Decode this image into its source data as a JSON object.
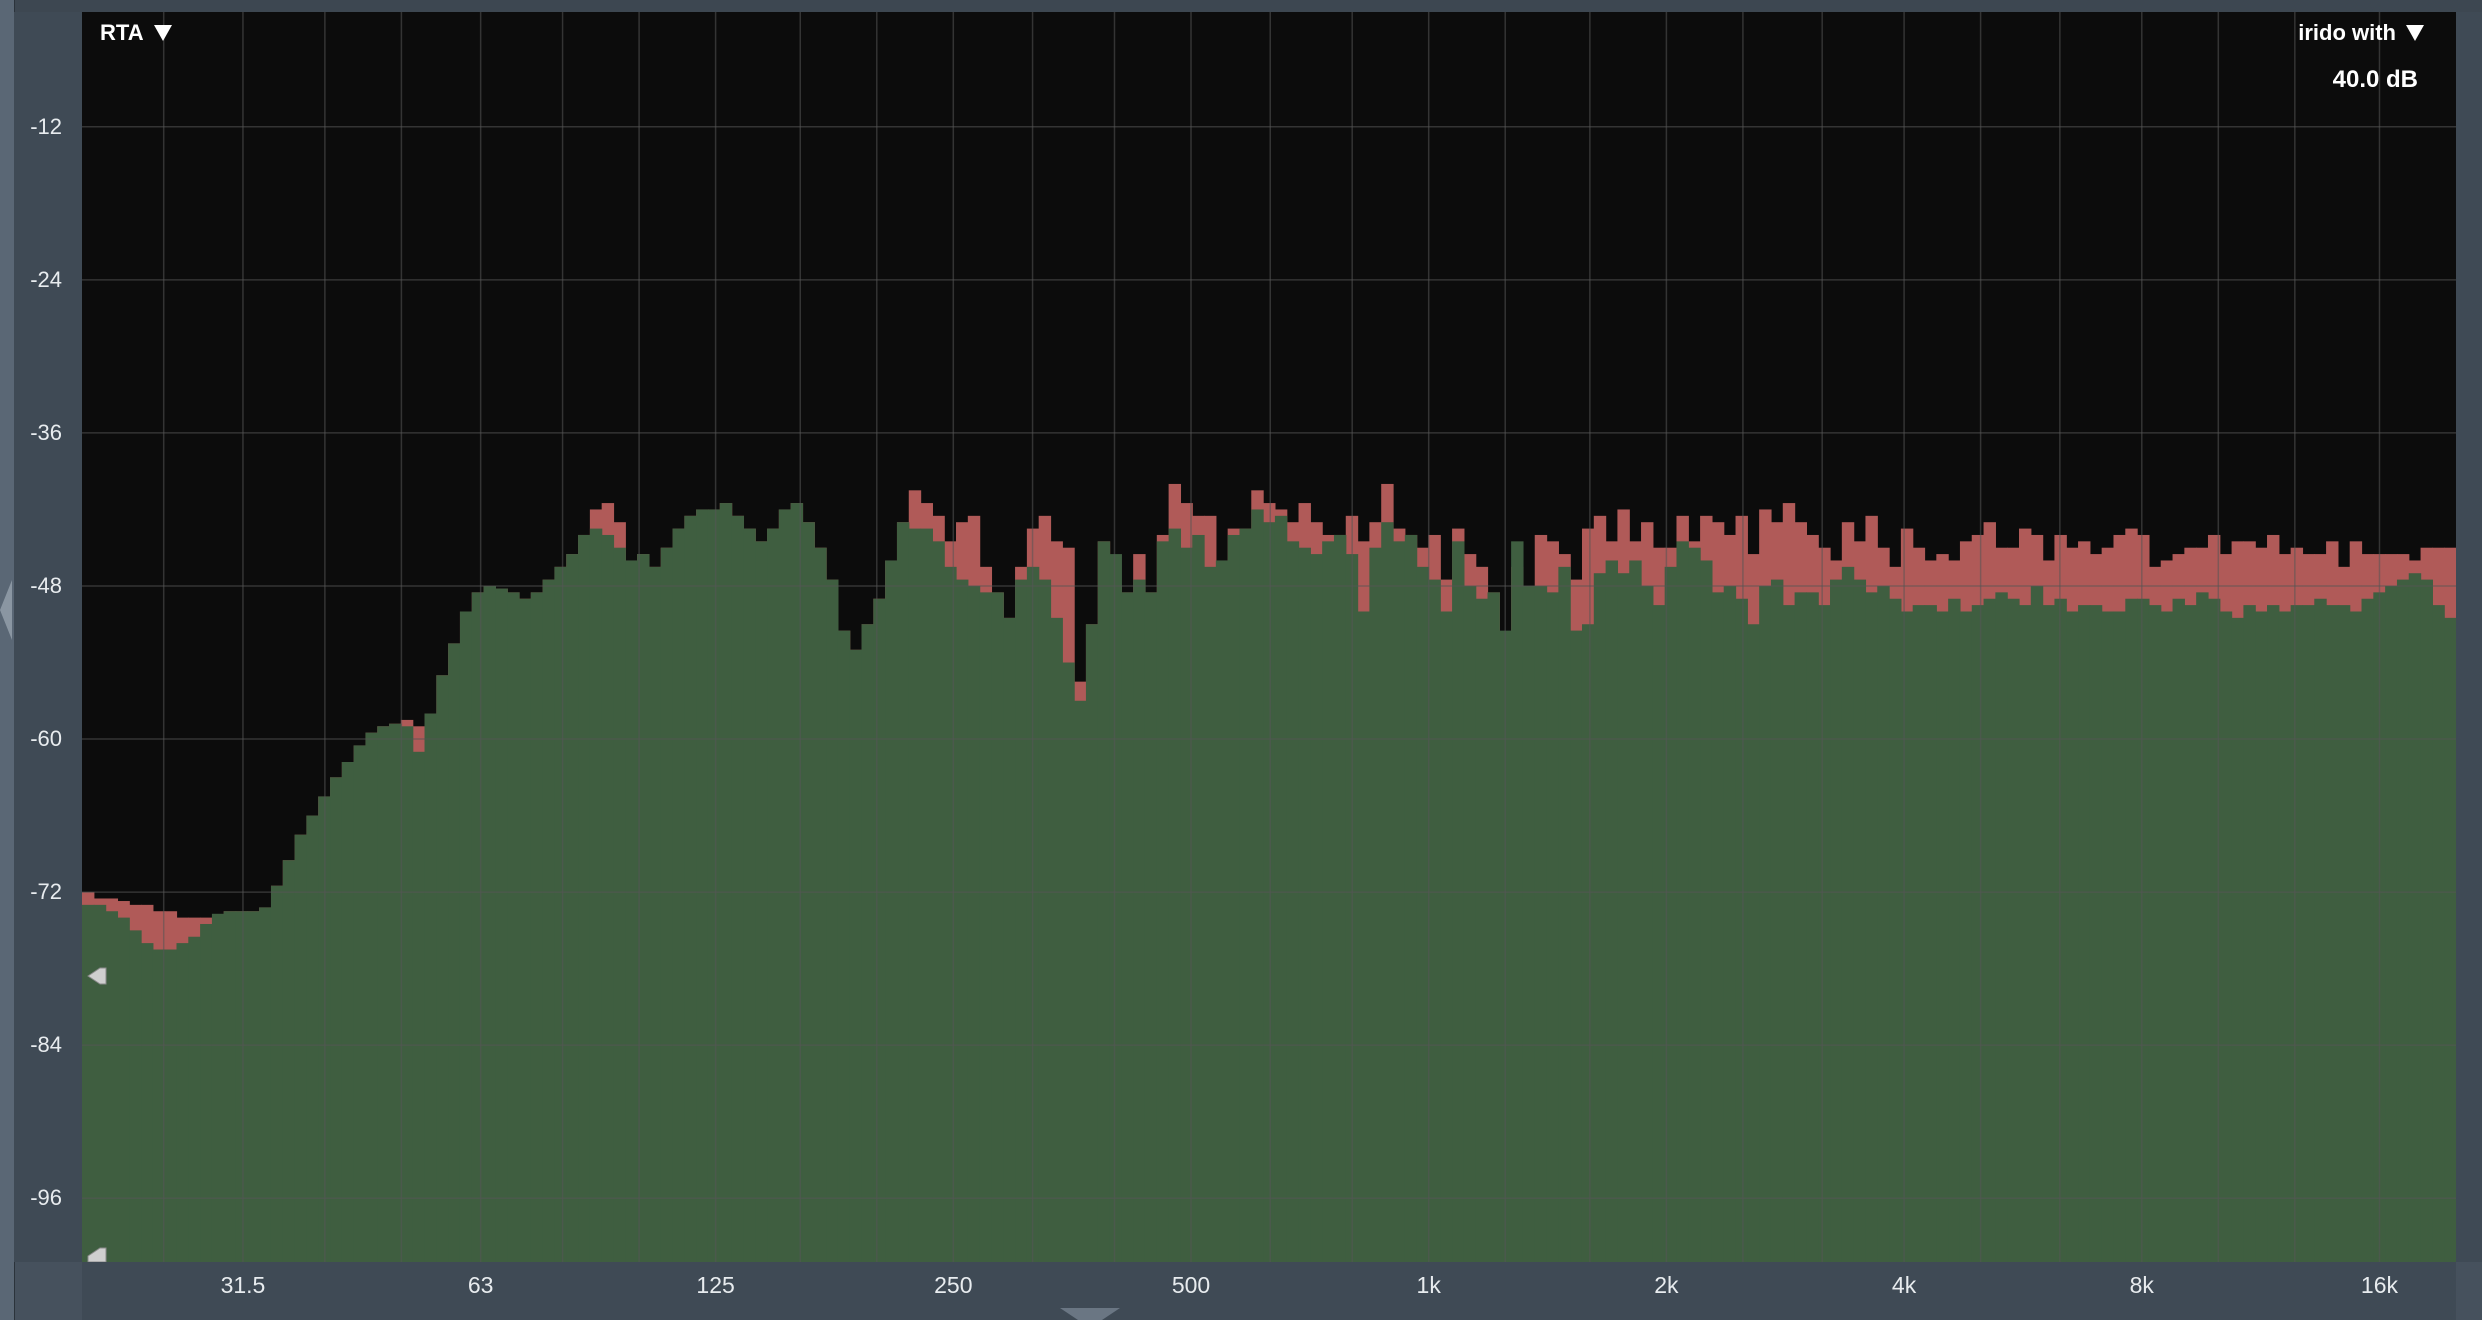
{
  "header": {
    "rta_label": "RTA",
    "reference_label": "irido with",
    "range_label": "40.0 dB"
  },
  "colors": {
    "current_fill": "#3f5e40",
    "difference_fill": "#b05a58",
    "background": "#0c0c0c",
    "grid": "#3a3a3a"
  },
  "chart_data": {
    "type": "bar",
    "title": "",
    "xscale": "log",
    "xlim": [
      19.7,
      20000
    ],
    "ylim": [
      -101,
      -3
    ],
    "y_ticks": [
      -12,
      -24,
      -36,
      -48,
      -60,
      -72,
      -84,
      -96
    ],
    "x_tick_values": [
      31.5,
      63,
      125,
      250,
      500,
      1000,
      2000,
      4000,
      8000,
      16000
    ],
    "x_tick_labels": [
      "31.5",
      "63",
      "125",
      "250",
      "500",
      "1k",
      "2k",
      "4k",
      "8k",
      "16k"
    ],
    "x_minor_grid": [
      25,
      40,
      50,
      80,
      100,
      160,
      200,
      315,
      400,
      630,
      800,
      1250,
      1600,
      2500,
      3150,
      5000,
      6300,
      10000,
      12500
    ],
    "grid": true,
    "series": [
      {
        "values": [
          -73,
          -73,
          -73.5,
          -74,
          -75,
          -76,
          -76.5,
          -76.5,
          -76,
          -75.5,
          -74.5,
          -73.7,
          -73.5,
          -73.5,
          -73.5,
          -73.2,
          -71.5,
          -69.5,
          -67.5,
          -66,
          -64.5,
          -63,
          -61.8,
          -60.5,
          -59.5,
          -59,
          -58.8,
          -59,
          -61,
          -58,
          -55,
          -52.5,
          -50,
          -48.5,
          -48,
          -48.2,
          -48.5,
          -49,
          -48.5,
          -47.5,
          -46.5,
          -45.5,
          -44,
          -43.5,
          -44,
          -45,
          -46,
          -45.5,
          -46.5,
          -45,
          -43.5,
          -42.5,
          -42,
          -42,
          -41.5,
          -42.5,
          -43.5,
          -44.5,
          -43.5,
          -42,
          -41.5,
          -43,
          -45,
          -47.5,
          -51.5,
          -53,
          -51,
          -49,
          -46,
          -43,
          -43.5,
          -43.5,
          -44.5,
          -46.5,
          -47.5,
          -48,
          -48.5,
          -48.5,
          -50.5,
          -47.5,
          -46.5,
          -47.5,
          -50.5,
          -54,
          -57,
          -51,
          -44.5,
          -45.5,
          -48.5,
          -47.5,
          -48.5,
          -44.5,
          -43.5,
          -45,
          -44,
          -46.5,
          -46,
          -44,
          -43.5,
          -42,
          -43,
          -42.5,
          -44.5,
          -45,
          -45.5,
          -44.5,
          -44,
          -45.5,
          -50,
          -45,
          -43,
          -44.5,
          -44,
          -46.5,
          -47.5,
          -50,
          -44.5,
          -48,
          -49,
          -48.5,
          -51.5,
          -44.5,
          -48,
          -48,
          -48.5,
          -46.5,
          -51.5,
          -51,
          -47,
          -46,
          -47,
          -46,
          -48,
          -49.5,
          -46.5,
          -44.5,
          -45,
          -46,
          -48.5,
          -48,
          -49,
          -51,
          -48,
          -47.5,
          -49.5,
          -48.5,
          -48.5,
          -49.5,
          -47.5,
          -46.5,
          -47.5,
          -48.5,
          -48,
          -49,
          -50,
          -49.5,
          -49.5,
          -50,
          -49,
          -50,
          -49.5,
          -49,
          -48.5,
          -49,
          -49.5,
          -48,
          -49.5,
          -49,
          -50,
          -49.5,
          -49.5,
          -50,
          -50,
          -49,
          -49,
          -49.5,
          -50,
          -49,
          -49.5,
          -48.5,
          -49,
          -50,
          -50.5,
          -49.5,
          -50,
          -49.5,
          -50,
          -49.5,
          -49.5,
          -49,
          -49.5,
          -49.5,
          -50,
          -49,
          -48.5,
          -48,
          -47.5,
          -47,
          -47.5,
          -49.5,
          -50.5
        ]
      },
      {
        "values": [
          -72,
          -72.5,
          -72.5,
          -72.7,
          -73,
          -73,
          -73.5,
          -73.5,
          -74,
          -74,
          -74,
          -74,
          -73.5,
          -73.5,
          -73.5,
          -73.2,
          -71.5,
          -69.5,
          -67.5,
          -66,
          -64.5,
          -63,
          -61.8,
          -60.5,
          -59.5,
          -59,
          -58.8,
          -58.5,
          -59,
          -58,
          -55,
          -52.5,
          -50,
          -48.5,
          -48,
          -48.2,
          -48.5,
          -49,
          -48.5,
          -47.5,
          -46.5,
          -45.5,
          -44,
          -42,
          -41.5,
          -43,
          -46,
          -45.5,
          -46.5,
          -45,
          -43.5,
          -42.5,
          -42,
          -42,
          -41.5,
          -42.5,
          -43.5,
          -44.5,
          -43.5,
          -42,
          -41.5,
          -43,
          -45,
          -47.5,
          -51.5,
          -53,
          -51,
          -49,
          -46,
          -43,
          -40.5,
          -41.5,
          -42.5,
          -44.5,
          -43,
          -42.5,
          -46.5,
          -48.5,
          -50.5,
          -46.5,
          -43.5,
          -42.5,
          -44.5,
          -45,
          -55.5,
          -51,
          -44.5,
          -48,
          -48.5,
          -45.5,
          -48.5,
          -44,
          -40,
          -41.5,
          -42.5,
          -42.5,
          -46,
          -43.5,
          -43.5,
          -40.5,
          -41.5,
          -42,
          -43,
          -41.5,
          -43,
          -44,
          -44,
          -42.5,
          -44.5,
          -43,
          -40,
          -43.5,
          -44,
          -45,
          -44,
          -47.5,
          -43.5,
          -45.5,
          -46.5,
          -48.5,
          -53,
          -46.5,
          -48,
          -44,
          -44.5,
          -45.5,
          -47.5,
          -43.5,
          -42.5,
          -44.5,
          -42,
          -44.5,
          -43,
          -45,
          -45,
          -42.5,
          -44.5,
          -42.5,
          -43,
          -44,
          -42.5,
          -45.5,
          -42,
          -43,
          -41.5,
          -43,
          -44,
          -45,
          -46,
          -43,
          -44.5,
          -42.5,
          -45,
          -46.5,
          -43.5,
          -45,
          -46,
          -45.5,
          -46,
          -44.5,
          -44,
          -43,
          -45,
          -45,
          -43.5,
          -44,
          -46,
          -44,
          -45,
          -44.5,
          -45.5,
          -45,
          -44,
          -43.5,
          -44,
          -46.5,
          -46,
          -45.5,
          -45,
          -45,
          -44,
          -45.5,
          -44.5,
          -44.5,
          -45,
          -44,
          -45.5,
          -45,
          -45.5,
          -45.5,
          -44.5,
          -46.5,
          -44.5,
          -45.5,
          -45.5,
          -45.5,
          -45.5,
          -46,
          -45,
          -45,
          -45,
          -46.5,
          -45.5,
          -45,
          -44.5,
          -45,
          -48
        ]
      }
    ]
  }
}
